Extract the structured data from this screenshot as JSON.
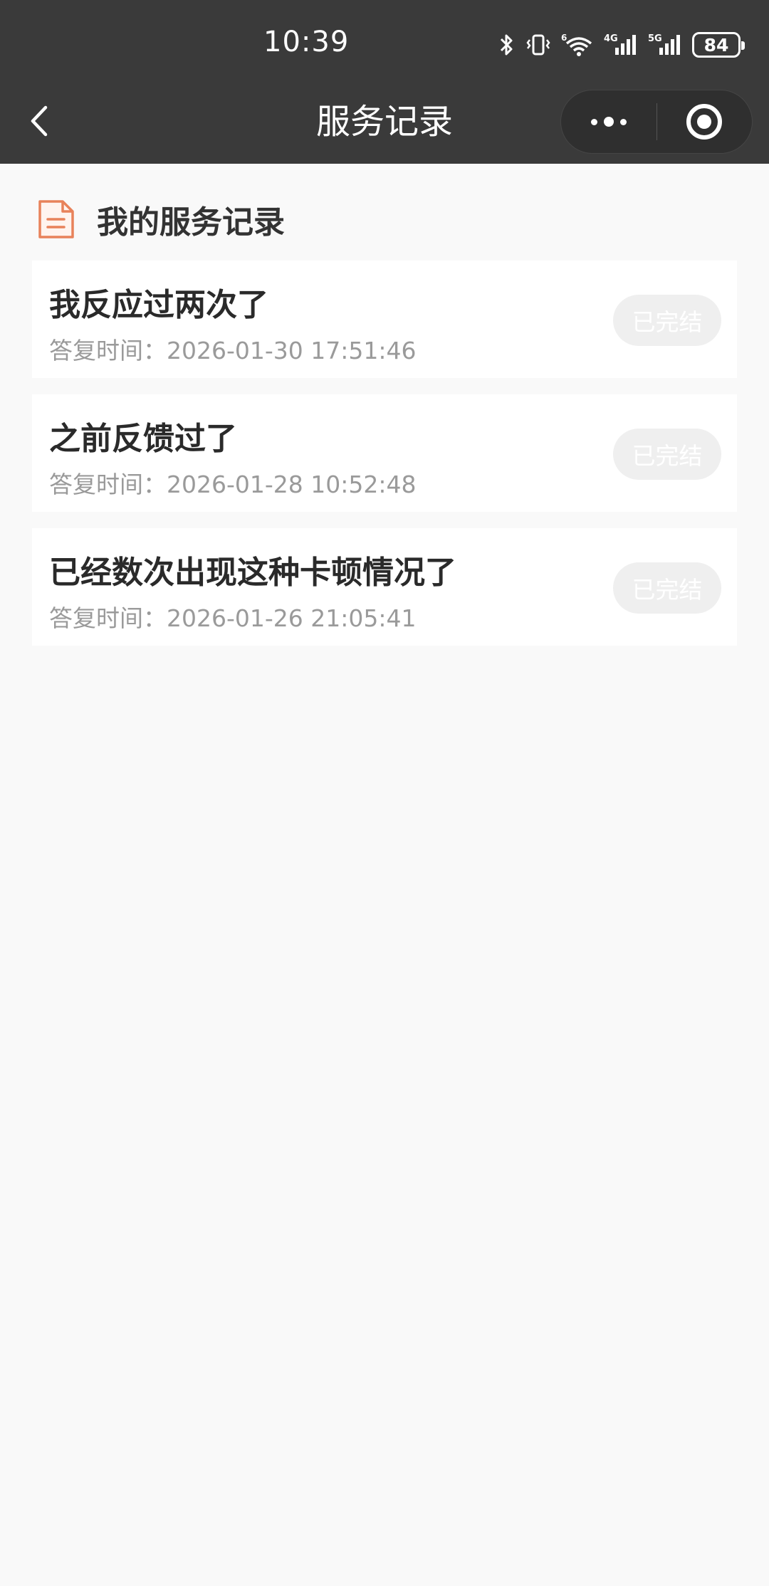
{
  "status_bar": {
    "time": "10:39",
    "battery": "84",
    "icons": [
      "bluetooth-icon",
      "vibrate-icon",
      "wifi-icon",
      "signal-4g-icon",
      "signal-5g-icon",
      "battery-icon"
    ],
    "net_labels": {
      "wifi": "6",
      "sim1": "4G",
      "sim2": "5G"
    }
  },
  "nav": {
    "back_icon": "chevron-left-icon",
    "title": "服务记录",
    "more_icon": "more-dots-icon",
    "close_icon": "target-circle-icon"
  },
  "section": {
    "icon": "document-icon",
    "title": "我的服务记录",
    "accent_color": "#e8825a"
  },
  "records": [
    {
      "title": "我反应过两次了",
      "reply_label": "答复时间：",
      "reply_time": "2026-01-30 17:51:46",
      "status": "已完结"
    },
    {
      "title": "之前反馈过了",
      "reply_label": "答复时间：",
      "reply_time": "2026-01-28 10:52:48",
      "status": "已完结"
    },
    {
      "title": "已经数次出现这种卡顿情况了",
      "reply_label": "答复时间：",
      "reply_time": "2026-01-26 21:05:41",
      "status": "已完结"
    }
  ]
}
